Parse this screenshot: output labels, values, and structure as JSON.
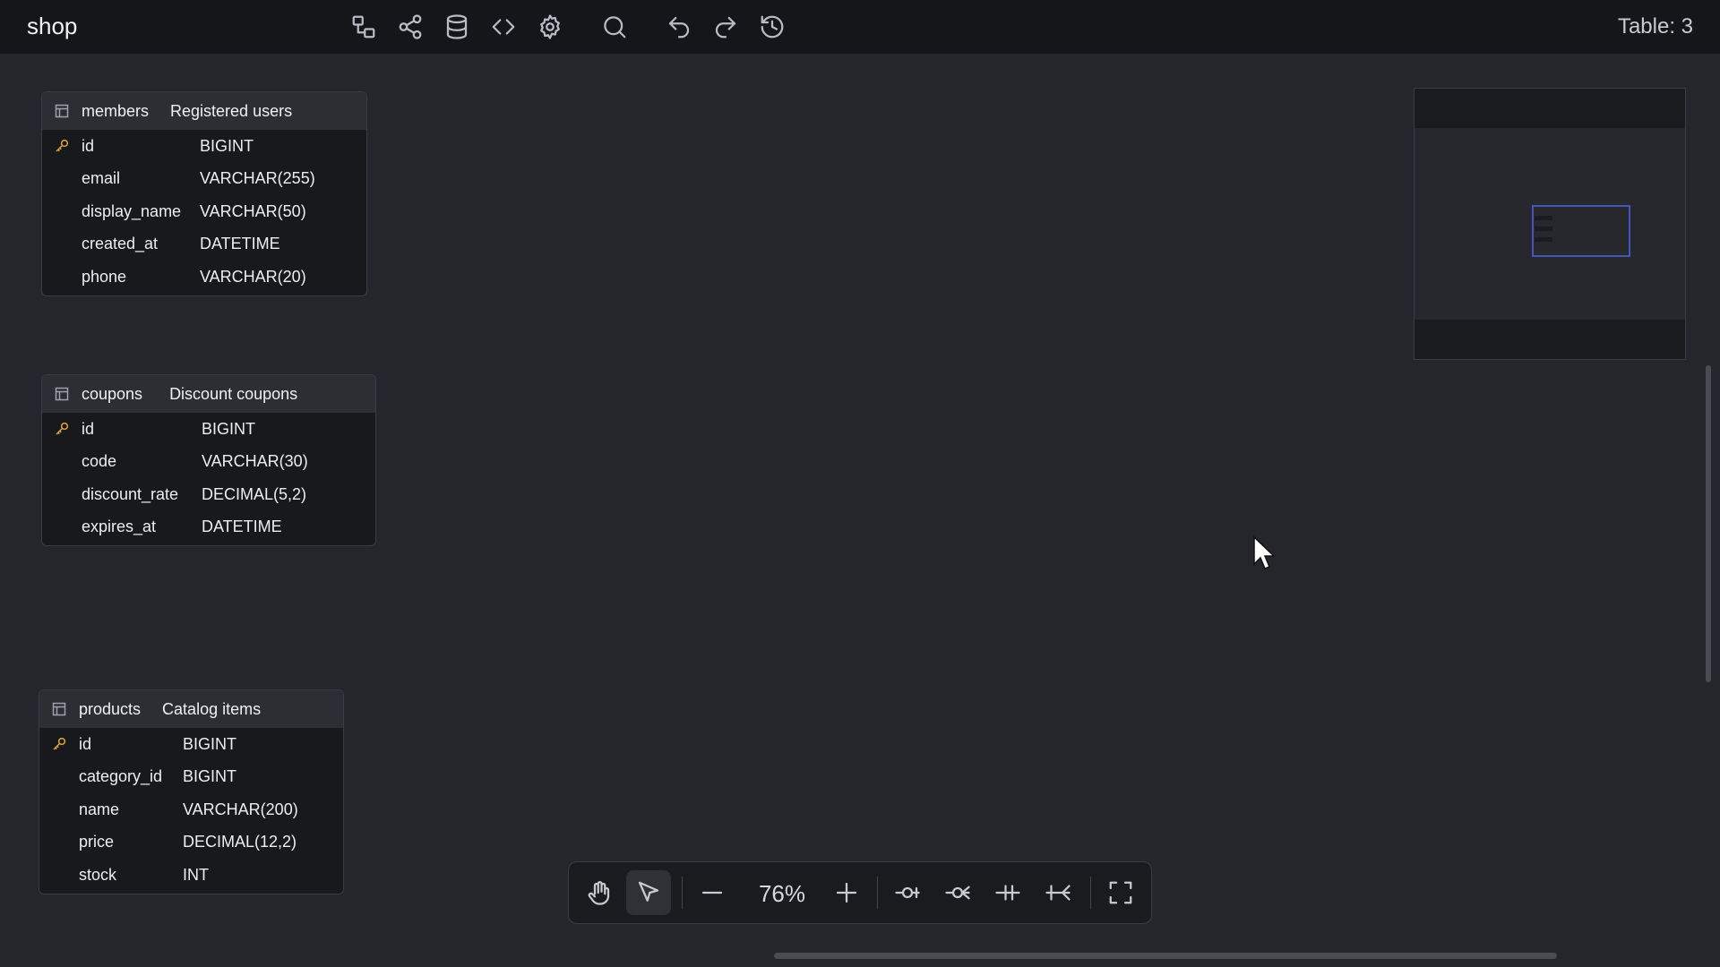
{
  "app": {
    "title": "shop",
    "table_count": "Table: 3"
  },
  "toolbar": {
    "icons": [
      "diagram-icon",
      "share-icon",
      "database-icon",
      "code-icon",
      "gear-icon",
      "search-icon",
      "undo-icon",
      "redo-icon",
      "history-icon"
    ]
  },
  "tables": [
    {
      "name": "members",
      "comment": "Registered users",
      "columns": [
        {
          "name": "id",
          "type": "BIGINT",
          "pk": true
        },
        {
          "name": "email",
          "type": "VARCHAR(255)",
          "pk": false
        },
        {
          "name": "display_name",
          "type": "VARCHAR(50)",
          "pk": false
        },
        {
          "name": "created_at",
          "type": "DATETIME",
          "pk": false
        },
        {
          "name": "phone",
          "type": "VARCHAR(20)",
          "pk": false
        }
      ]
    },
    {
      "name": "coupons",
      "comment": "Discount coupons",
      "columns": [
        {
          "name": "id",
          "type": "BIGINT",
          "pk": true
        },
        {
          "name": "code",
          "type": "VARCHAR(30)",
          "pk": false
        },
        {
          "name": "discount_rate",
          "type": "DECIMAL(5,2)",
          "pk": false
        },
        {
          "name": "expires_at",
          "type": "DATETIME",
          "pk": false
        }
      ]
    },
    {
      "name": "products",
      "comment": "Catalog items",
      "columns": [
        {
          "name": "id",
          "type": "BIGINT",
          "pk": true
        },
        {
          "name": "category_id",
          "type": "BIGINT",
          "pk": false
        },
        {
          "name": "name",
          "type": "VARCHAR(200)",
          "pk": false
        },
        {
          "name": "price",
          "type": "DECIMAL(12,2)",
          "pk": false
        },
        {
          "name": "stock",
          "type": "INT",
          "pk": false
        }
      ]
    }
  ],
  "bottom_toolbar": {
    "zoom": "76%",
    "icons": [
      "hand-icon",
      "pointer-icon",
      "zoom-out-icon",
      "zoom-in-icon",
      "relation-one-icon",
      "relation-many-icon",
      "relation-one-one-icon",
      "relation-one-many-icon",
      "fullscreen-icon"
    ]
  },
  "colors": {
    "background": "#24262b",
    "topbar": "#15161a",
    "primary_key": "#e0a63a",
    "minimap_viewport": "#4457b8"
  }
}
